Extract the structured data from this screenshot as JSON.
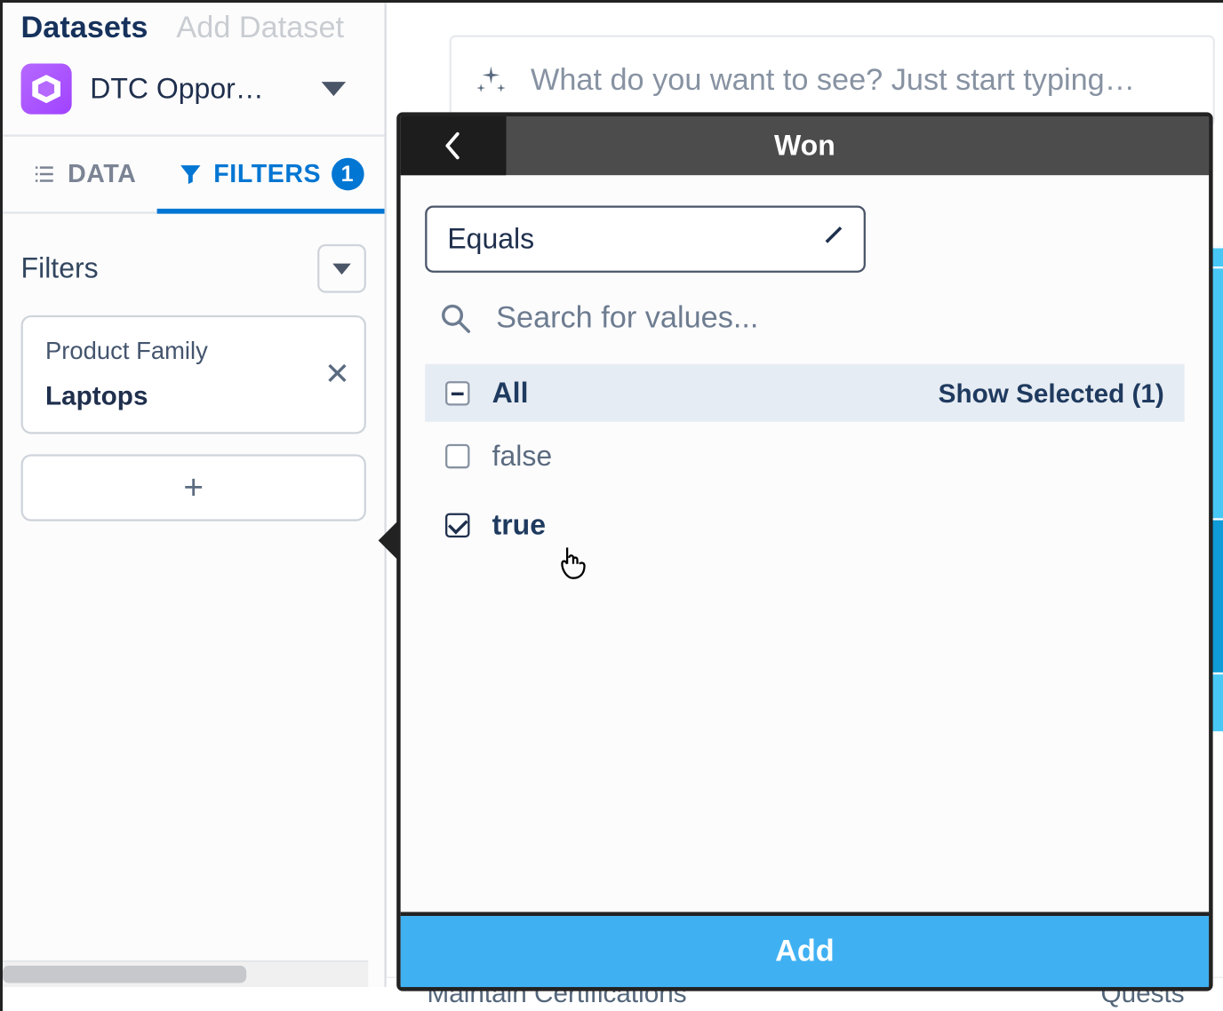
{
  "sidebar": {
    "datasets_label": "Datasets",
    "add_dataset_label": "Add Dataset",
    "dataset_name": "DTC Oppor…",
    "tabs": {
      "data": "DATA",
      "filters": "FILTERS",
      "filters_count": "1"
    },
    "filters_heading": "Filters",
    "filter_cards": [
      {
        "field": "Product Family",
        "value": "Laptops"
      }
    ],
    "add_filter_glyph": "+"
  },
  "main": {
    "prompt_placeholder": "What do you want to see? Just start typing…"
  },
  "panel": {
    "title": "Won",
    "operator": "Equals",
    "search_placeholder": "Search for values...",
    "all_label": "All",
    "show_selected_label": "Show Selected (1)",
    "values": [
      {
        "label": "false",
        "checked": false
      },
      {
        "label": "true",
        "checked": true
      }
    ],
    "add_button": "Add"
  },
  "bottom": {
    "left_text": "Maintain Certifications",
    "right_text": "Quests"
  }
}
